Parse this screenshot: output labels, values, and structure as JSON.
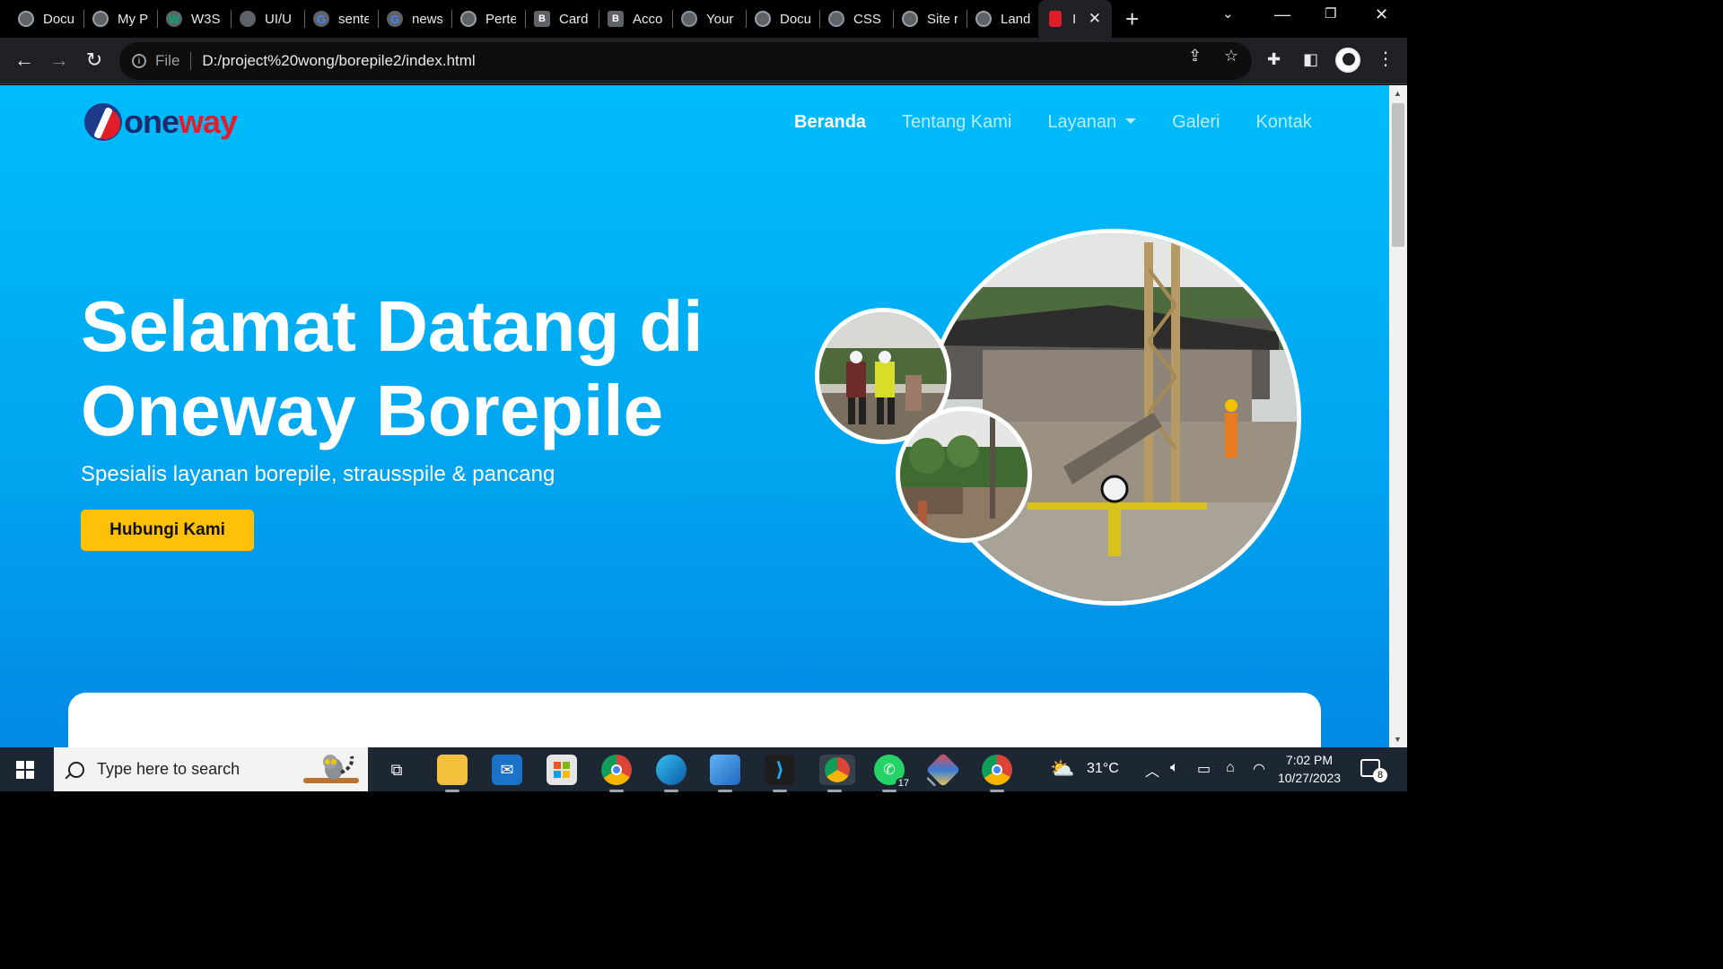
{
  "browser": {
    "tabs": [
      {
        "label": "Docu",
        "icon": "globe-icon"
      },
      {
        "label": "My P",
        "icon": "globe-icon"
      },
      {
        "label": "W3S",
        "icon": "w3schools-icon"
      },
      {
        "label": "UI/U",
        "icon": "chatgpt-icon"
      },
      {
        "label": "sente",
        "icon": "google-icon"
      },
      {
        "label": "news",
        "icon": "google-icon"
      },
      {
        "label": "Perte",
        "icon": "globe-icon"
      },
      {
        "label": "Card",
        "icon": "bootstrap-icon"
      },
      {
        "label": "Acco",
        "icon": "bootstrap-icon"
      },
      {
        "label": "Your",
        "icon": "github-icon"
      },
      {
        "label": "Docu",
        "icon": "globe-icon"
      },
      {
        "label": "CSS r",
        "icon": "github-icon"
      },
      {
        "label": "Site r",
        "icon": "globe-icon"
      },
      {
        "label": "Land",
        "icon": "globe-icon"
      },
      {
        "label": "I",
        "icon": "site-favicon",
        "active": true
      }
    ],
    "address": {
      "scheme_label": "File",
      "url": "D:/project%20wong/borepile2/index.html"
    }
  },
  "site": {
    "logo": {
      "part1": "one",
      "part2": "way"
    },
    "nav": [
      {
        "label": "Beranda",
        "active": true
      },
      {
        "label": "Tentang Kami"
      },
      {
        "label": "Layanan",
        "dropdown": true
      },
      {
        "label": "Galeri"
      },
      {
        "label": "Kontak"
      }
    ],
    "hero": {
      "title": "Selamat Datang di Oneway Borepile",
      "subtitle": "Spesialis layanan borepile, strausspile & pancang",
      "cta_label": "Hubungi Kami"
    },
    "colors": {
      "hero_top": "#00bcfa",
      "hero_bottom": "#0189e4",
      "cta": "#ffc107",
      "logo_red": "#e11d2a",
      "logo_navy": "#1e2a6b"
    }
  },
  "taskbar": {
    "search_placeholder": "Type here to search",
    "whatsapp_badge": "17",
    "weather": "31°C",
    "time": "7:02 PM",
    "date": "10/27/2023",
    "notification_count": "8"
  }
}
